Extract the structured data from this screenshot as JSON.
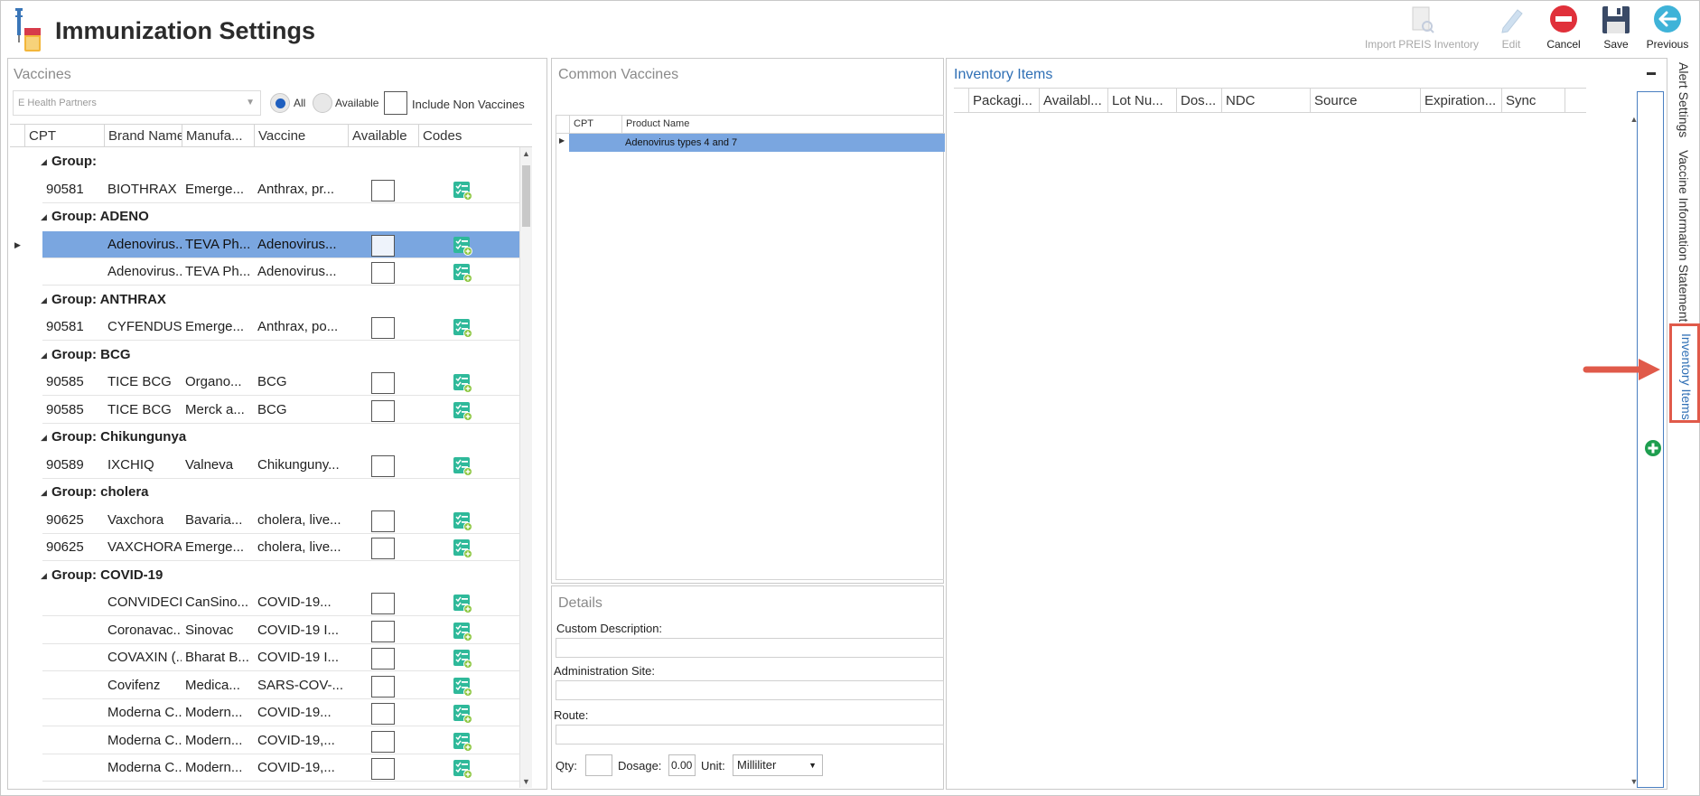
{
  "header": {
    "title": "Immunization Settings"
  },
  "toolbar": {
    "import": "Import PREIS Inventory",
    "edit": "Edit",
    "cancel": "Cancel",
    "save": "Save",
    "previous": "Previous"
  },
  "vaccines": {
    "title": "Vaccines",
    "dropdown_value": "E Health Partners",
    "radio_all": "All",
    "radio_available": "Available",
    "include_non_vaccines": "Include Non Vaccines",
    "columns": [
      "CPT",
      "Brand Name",
      "Manufa...",
      "Vaccine",
      "Available",
      "Codes"
    ],
    "rows": [
      {
        "type": "group",
        "label": "Group:"
      },
      {
        "type": "row",
        "cpt": "90581",
        "brand": "BIOTHRAX",
        "manu": "Emerge...",
        "vaccine": "Anthrax, pr..."
      },
      {
        "type": "group",
        "label": "Group: ADENO"
      },
      {
        "type": "row",
        "cpt": "",
        "brand": "Adenovirus...",
        "manu": "TEVA Ph...",
        "vaccine": "Adenovirus...",
        "selected": true
      },
      {
        "type": "row",
        "cpt": "",
        "brand": "Adenovirus...",
        "manu": "TEVA Ph...",
        "vaccine": "Adenovirus..."
      },
      {
        "type": "group",
        "label": "Group: ANTHRAX"
      },
      {
        "type": "row",
        "cpt": "90581",
        "brand": "CYFENDUS",
        "manu": "Emerge...",
        "vaccine": "Anthrax, po..."
      },
      {
        "type": "group",
        "label": "Group: BCG"
      },
      {
        "type": "row",
        "cpt": "90585",
        "brand": "TICE BCG",
        "manu": "Organo...",
        "vaccine": "BCG"
      },
      {
        "type": "row",
        "cpt": "90585",
        "brand": "TICE BCG",
        "manu": "Merck a...",
        "vaccine": "BCG"
      },
      {
        "type": "group",
        "label": "Group: Chikungunya"
      },
      {
        "type": "row",
        "cpt": "90589",
        "brand": "IXCHIQ",
        "manu": "Valneva",
        "vaccine": "Chikunguny..."
      },
      {
        "type": "group",
        "label": "Group: cholera"
      },
      {
        "type": "row",
        "cpt": "90625",
        "brand": "Vaxchora",
        "manu": "Bavaria...",
        "vaccine": "cholera, live..."
      },
      {
        "type": "row",
        "cpt": "90625",
        "brand": "VAXCHORA",
        "manu": "Emerge...",
        "vaccine": "cholera, live..."
      },
      {
        "type": "group",
        "label": "Group: COVID-19"
      },
      {
        "type": "row",
        "cpt": "",
        "brand": "CONVIDECI...",
        "manu": "CanSino...",
        "vaccine": "COVID-19..."
      },
      {
        "type": "row",
        "cpt": "",
        "brand": "Coronavac...",
        "manu": "Sinovac",
        "vaccine": "COVID-19 I..."
      },
      {
        "type": "row",
        "cpt": "",
        "brand": "COVAXIN (...",
        "manu": "Bharat B...",
        "vaccine": "COVID-19 I..."
      },
      {
        "type": "row",
        "cpt": "",
        "brand": "Covifenz",
        "manu": "Medica...",
        "vaccine": "SARS-COV-..."
      },
      {
        "type": "row",
        "cpt": "",
        "brand": "Moderna C...",
        "manu": "Modern...",
        "vaccine": "COVID-19..."
      },
      {
        "type": "row",
        "cpt": "",
        "brand": "Moderna C...",
        "manu": "Modern...",
        "vaccine": "COVID-19,..."
      },
      {
        "type": "row",
        "cpt": "",
        "brand": "Moderna C...",
        "manu": "Modern...",
        "vaccine": "COVID-19,..."
      }
    ]
  },
  "common": {
    "title": "Common Vaccines",
    "columns": [
      "CPT",
      "Product Name"
    ],
    "row": {
      "cpt": "",
      "product": "Adenovirus types 4 and 7"
    }
  },
  "details": {
    "title": "Details",
    "custom_description": "Custom Description:",
    "administration_site": "Administration Site:",
    "route": "Route:",
    "qty": "Qty:",
    "dosage": "Dosage:",
    "dosage_value": "0.00",
    "unit": "Unit:",
    "unit_value": "Milliliter"
  },
  "inventory": {
    "title": "Inventory Items",
    "columns": [
      "Packagi...",
      "Availabl...",
      "Lot Nu...",
      "Dos...",
      "NDC",
      "Source",
      "Expiration...",
      "Sync"
    ]
  },
  "side_tabs": {
    "alert": "Alert Settings",
    "vis": "Vaccine Information Statement",
    "inventory": "Inventory Items"
  },
  "colors": {
    "accent": "#2f6fb5",
    "selected_row": "#7aa6e0",
    "annotation": "#e05a4a",
    "cancel_red": "#e0303a",
    "code_green": "#2fb99a"
  }
}
